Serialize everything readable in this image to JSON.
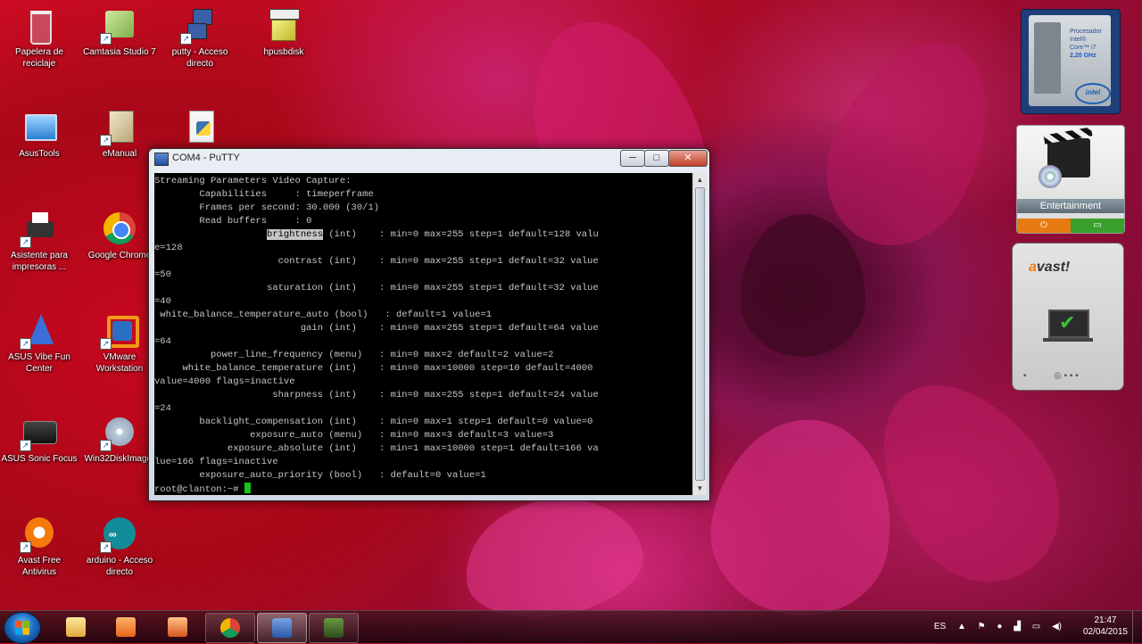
{
  "desktop": {
    "icons": [
      {
        "label": "Papelera de reciclaje"
      },
      {
        "label": "Camtasia Studio 7"
      },
      {
        "label": "putty - Acceso directo"
      },
      {
        "label": "hpusbdisk"
      },
      {
        "label": "AsusTools"
      },
      {
        "label": "eManual"
      },
      {
        "label": ""
      },
      {
        "label": "Asistente para impresoras ..."
      },
      {
        "label": "Google Chrome"
      },
      {
        "label": "ASUS Vibe Fun Center"
      },
      {
        "label": "VMware Workstation"
      },
      {
        "label": "ASUS Sonic Focus"
      },
      {
        "label": "Win32DiskImager"
      },
      {
        "label": "Avast Free Antivirus"
      },
      {
        "label": "arduino - Acceso directo"
      }
    ]
  },
  "putty": {
    "title": "COM4 - PuTTY",
    "buttons": {
      "minimize": "─",
      "maximize": "□",
      "close": "✕"
    },
    "lines_before": [
      "Streaming Parameters Video Capture:",
      "        Capabilities     : timeperframe",
      "        Frames per second: 30.000 (30/1)",
      "        Read buffers     : 0"
    ],
    "brightness_pre": "                    ",
    "brightness_word": "brightness",
    "brightness_post": " (int)    : min=0 max=255 step=1 default=128 valu",
    "lines_after": [
      "e=128",
      "                      contrast (int)    : min=0 max=255 step=1 default=32 value",
      "=50",
      "                    saturation (int)    : min=0 max=255 step=1 default=32 value",
      "=40",
      " white_balance_temperature_auto (bool)   : default=1 value=1",
      "                          gain (int)    : min=0 max=255 step=1 default=64 value",
      "=64",
      "          power_line_frequency (menu)   : min=0 max=2 default=2 value=2",
      "     white_balance_temperature (int)    : min=0 max=10000 step=10 default=4000",
      "value=4000 flags=inactive",
      "                     sharpness (int)    : min=0 max=255 step=1 default=24 value",
      "=24",
      "        backlight_compensation (int)    : min=0 max=1 step=1 default=0 value=0",
      "                 exposure_auto (menu)   : min=0 max=3 default=3 value=3",
      "             exposure_absolute (int)    : min=1 max=10000 step=1 default=166 va",
      "lue=166 flags=inactive",
      "        exposure_auto_priority (bool)   : default=0 value=1"
    ],
    "prompt": "root@clanton:~# "
  },
  "gadgets": {
    "cpu": {
      "line1": "Procesador",
      "line2": "Intel®",
      "line3": "Core™ i7",
      "speed": "2,20 GHz",
      "brand": "intel"
    },
    "entertainment": {
      "label": "Entertainment"
    },
    "avast": {
      "logo_a": "a",
      "logo_rest": "vast!"
    }
  },
  "taskbar": {
    "tray_lang": "ES",
    "time": "21:47",
    "date": "02/04/2015"
  },
  "colors": {
    "terminal_bg": "#000000",
    "terminal_fg": "#c6c6c6",
    "cursor": "#18c418"
  }
}
